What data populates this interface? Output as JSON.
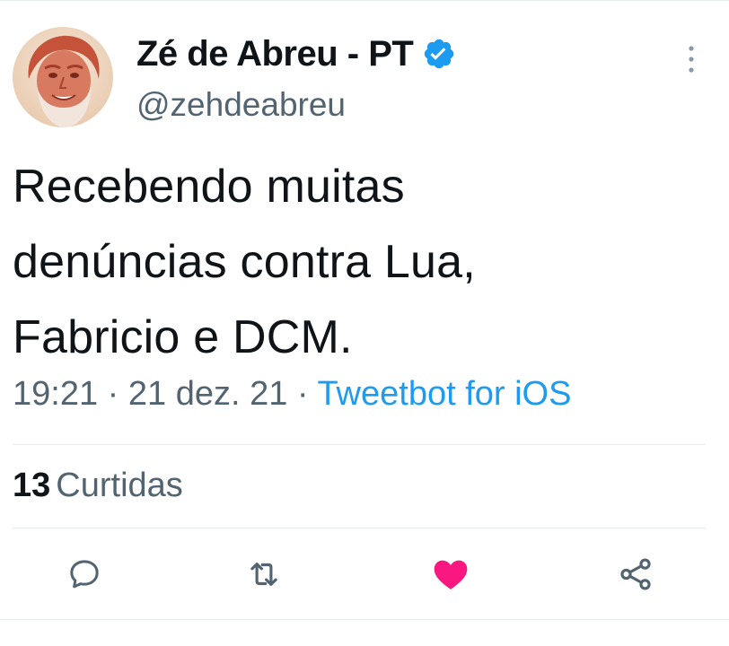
{
  "tweet": {
    "author": {
      "display_name": "Zé de Abreu - PT",
      "handle": "@zehdeabreu",
      "verified": true,
      "avatar": "avatar-photo"
    },
    "text_lines": [
      "Recebendo muitas",
      "denúncias contra Lua,",
      "Fabricio e DCM."
    ],
    "timestamp": "19:21 · 21 dez. 21",
    "separator": " · ",
    "source": "Tweetbot for iOS",
    "likes_count": "13",
    "likes_label": "Curtidas"
  },
  "actions": [
    {
      "name": "reply",
      "icon": "speech-bubble-icon"
    },
    {
      "name": "retweet",
      "icon": "retweet-icon"
    },
    {
      "name": "like",
      "icon": "heart-icon",
      "active": true
    },
    {
      "name": "share",
      "icon": "share-icon"
    }
  ],
  "colors": {
    "accent": "#1d9bf0",
    "like_active": "#f91880",
    "muted_text": "#536471",
    "icon_gray": "#536471",
    "text": "#0f1419",
    "divider": "#e6ecf0"
  }
}
